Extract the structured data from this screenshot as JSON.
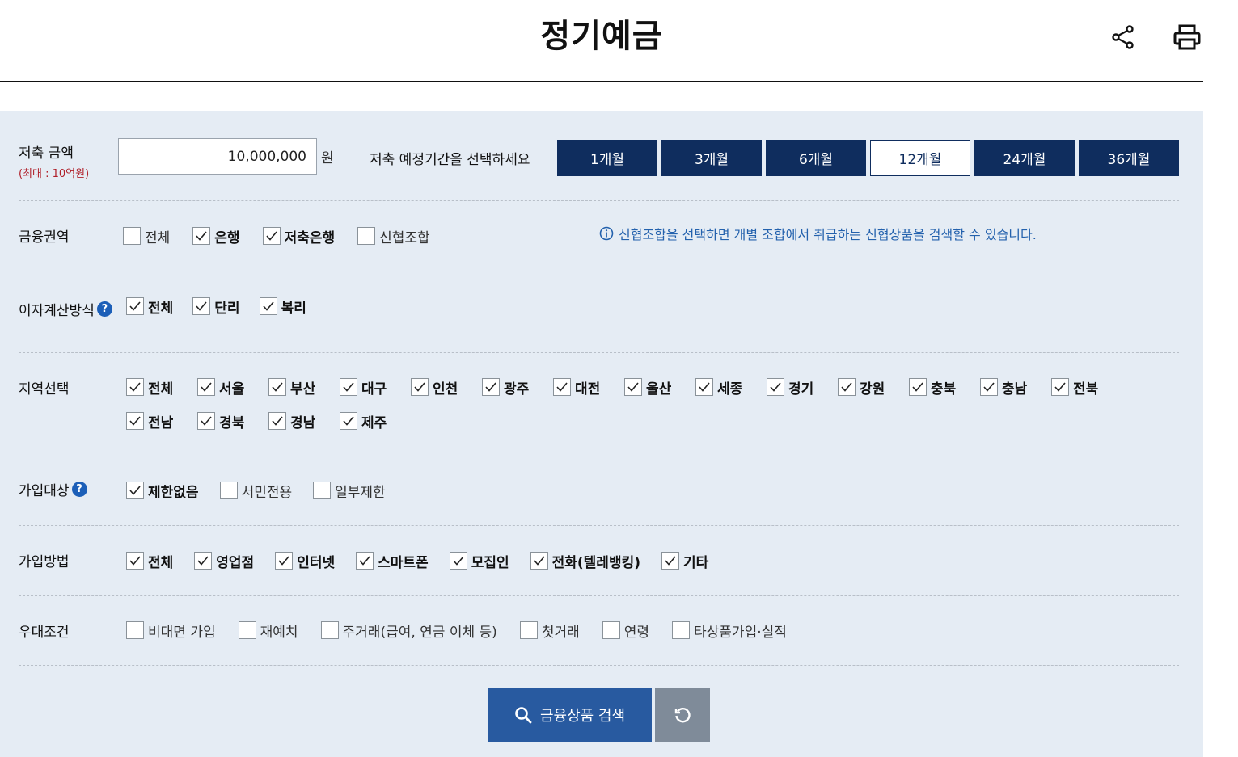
{
  "page": {
    "title": "정기예금"
  },
  "header": {
    "share_icon": "share-icon",
    "print_icon": "print-icon"
  },
  "amount": {
    "label": "저축 금액",
    "sub_label": "(최대 : 10억원)",
    "value": "10,000,000",
    "unit": "원"
  },
  "period": {
    "question": "저축 예정기간을 선택하세요",
    "options": [
      "1개월",
      "3개월",
      "6개월",
      "12개월",
      "24개월",
      "36개월"
    ],
    "selected": "12개월"
  },
  "sector": {
    "label": "금융권역",
    "options": [
      {
        "label": "전체",
        "checked": false
      },
      {
        "label": "은행",
        "checked": true
      },
      {
        "label": "저축은행",
        "checked": true
      },
      {
        "label": "신협조합",
        "checked": false
      }
    ],
    "notice": "신협조합을 선택하면 개별 조합에서 취급하는 신협상품을 검색할 수 있습니다."
  },
  "interest": {
    "label": "이자계산방식",
    "help": "?",
    "options": [
      {
        "label": "전체",
        "checked": true
      },
      {
        "label": "단리",
        "checked": true
      },
      {
        "label": "복리",
        "checked": true
      }
    ]
  },
  "region": {
    "label": "지역선택",
    "options": [
      {
        "label": "전체",
        "checked": true
      },
      {
        "label": "서울",
        "checked": true
      },
      {
        "label": "부산",
        "checked": true
      },
      {
        "label": "대구",
        "checked": true
      },
      {
        "label": "인천",
        "checked": true
      },
      {
        "label": "광주",
        "checked": true
      },
      {
        "label": "대전",
        "checked": true
      },
      {
        "label": "울산",
        "checked": true
      },
      {
        "label": "세종",
        "checked": true
      },
      {
        "label": "경기",
        "checked": true
      },
      {
        "label": "강원",
        "checked": true
      },
      {
        "label": "충북",
        "checked": true
      },
      {
        "label": "충남",
        "checked": true
      },
      {
        "label": "전북",
        "checked": true
      },
      {
        "label": "전남",
        "checked": true
      },
      {
        "label": "경북",
        "checked": true
      },
      {
        "label": "경남",
        "checked": true
      },
      {
        "label": "제주",
        "checked": true
      }
    ]
  },
  "target": {
    "label": "가입대상",
    "help": "?",
    "options": [
      {
        "label": "제한없음",
        "checked": true
      },
      {
        "label": "서민전용",
        "checked": false
      },
      {
        "label": "일부제한",
        "checked": false
      }
    ]
  },
  "method": {
    "label": "가입방법",
    "options": [
      {
        "label": "전체",
        "checked": true
      },
      {
        "label": "영업점",
        "checked": true
      },
      {
        "label": "인터넷",
        "checked": true
      },
      {
        "label": "스마트폰",
        "checked": true
      },
      {
        "label": "모집인",
        "checked": true
      },
      {
        "label": "전화(텔레뱅킹)",
        "checked": true
      },
      {
        "label": "기타",
        "checked": true
      }
    ]
  },
  "preference": {
    "label": "우대조건",
    "options": [
      {
        "label": "비대면 가입",
        "checked": false
      },
      {
        "label": "재예치",
        "checked": false
      },
      {
        "label": "주거래(급여, 연금 이체 등)",
        "checked": false
      },
      {
        "label": "첫거래",
        "checked": false
      },
      {
        "label": "연령",
        "checked": false
      },
      {
        "label": "타상품가입·실적",
        "checked": false
      }
    ]
  },
  "actions": {
    "search_label": "금융상품 검색",
    "search_icon": "search-icon",
    "reset_icon": "reset-icon"
  }
}
